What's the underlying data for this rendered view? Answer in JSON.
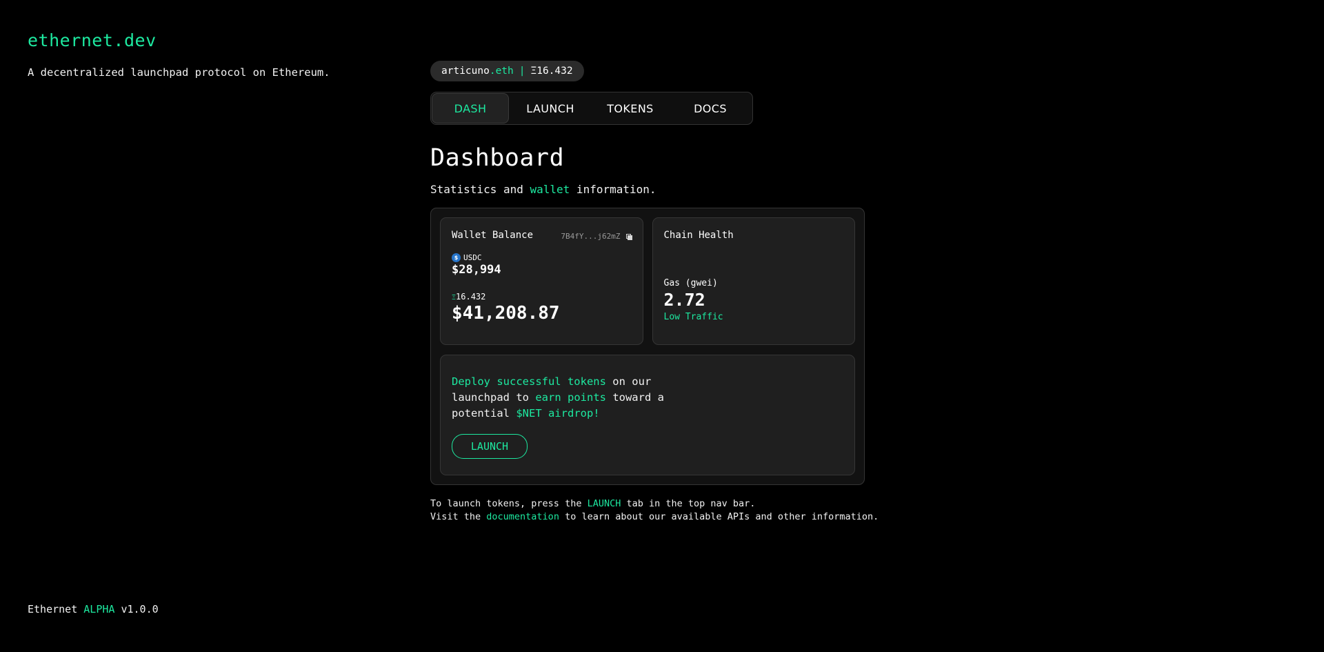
{
  "brand": {
    "name": "ethernet.dev",
    "tagline": "A decentralized launchpad protocol on Ethereum."
  },
  "wallet_pill": {
    "name": "articuno",
    "suffix": ".eth",
    "separator": "|",
    "balance": "Ξ16.432"
  },
  "nav": {
    "tabs": [
      {
        "label": "DASH",
        "active": true
      },
      {
        "label": "LAUNCH",
        "active": false
      },
      {
        "label": "TOKENS",
        "active": false
      },
      {
        "label": "DOCS",
        "active": false
      }
    ]
  },
  "page": {
    "title": "Dashboard",
    "subtitle_pre": "Statistics and ",
    "subtitle_accent": "wallet",
    "subtitle_post": " information."
  },
  "wallet_card": {
    "title": "Wallet Balance",
    "address": "7B4fY...j62mZ",
    "usdc_icon": "usdc-icon",
    "usdc_label": "USDC",
    "usdc_value": "$28,994",
    "eth_symbol": "Ξ",
    "eth_amount": "16.432",
    "eth_usd_value": "$41,208.87"
  },
  "chain_card": {
    "title": "Chain Health",
    "gas_label": "Gas (gwei)",
    "gas_value": "2.72",
    "traffic": "Low Traffic"
  },
  "promo": {
    "part1": "Deploy successful tokens",
    "part2": " on our launchpad to ",
    "part3": "earn points",
    "part4": " toward a potential ",
    "part5": "$NET airdrop!",
    "button": "LAUNCH"
  },
  "help": {
    "line1_pre": "To launch tokens, press the ",
    "line1_accent": "LAUNCH",
    "line1_post": " tab in the top nav bar.",
    "line2_pre": "Visit the ",
    "line2_link": "documentation",
    "line2_post": " to learn about our available APIs and other information."
  },
  "footer": {
    "name": "Ethernet",
    "stage": "ALPHA",
    "version": "v1.0.0"
  },
  "colors": {
    "background": "#000000",
    "accent": "#1de9a0",
    "card": "#1f1f1f",
    "border": "#363636"
  }
}
